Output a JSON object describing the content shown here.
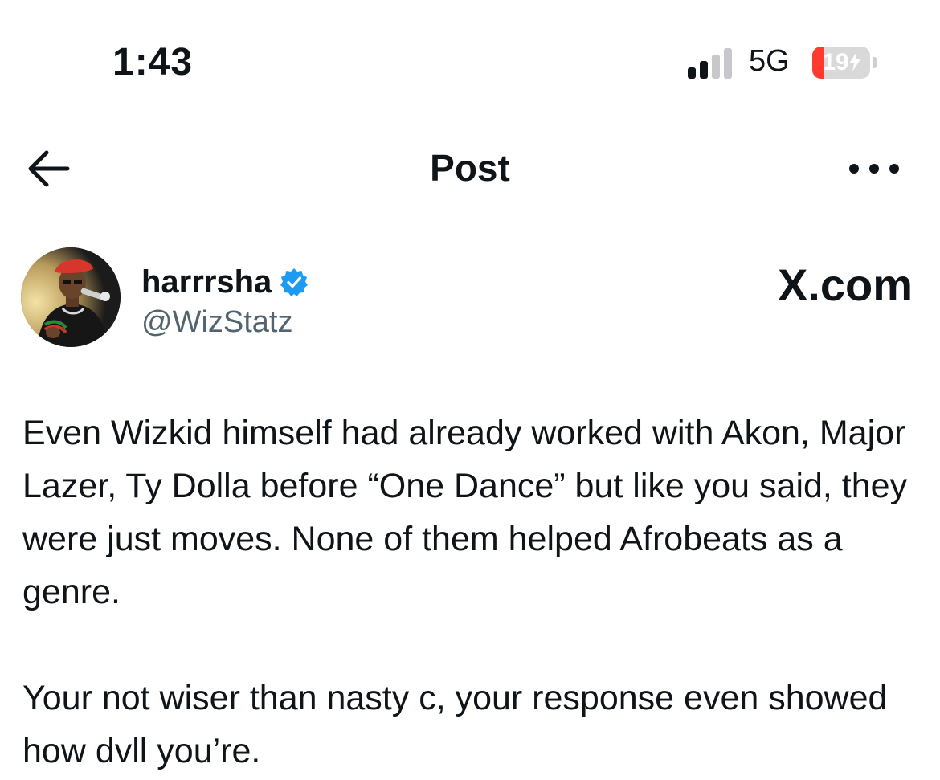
{
  "status_bar": {
    "time": "1:43",
    "network": "5G",
    "battery_level": "19",
    "battery_fraction": 0.19,
    "battery_color": "#ff3b30",
    "signal_bars_filled": 2,
    "signal_bars_total": 4,
    "icons": [
      "signal-icon",
      "battery-icon",
      "charging-bolt-icon"
    ]
  },
  "nav": {
    "title": "Post",
    "back_icon": "arrow-left-icon",
    "more_icon": "more-dots-icon"
  },
  "author": {
    "display_name": "harrrsha",
    "handle": "@WizStatz",
    "verified": true,
    "verified_color": "#1d9bf0"
  },
  "watermark": "X.com",
  "post": {
    "paragraphs": [
      "Even Wizkid himself had already worked with Akon, Major Lazer, Ty Dolla before “One Dance” but like you said, they were just moves. None of them helped Afrobeats as a genre.",
      "Your not wiser than nasty c, your response even showed how dvll you’re."
    ]
  }
}
